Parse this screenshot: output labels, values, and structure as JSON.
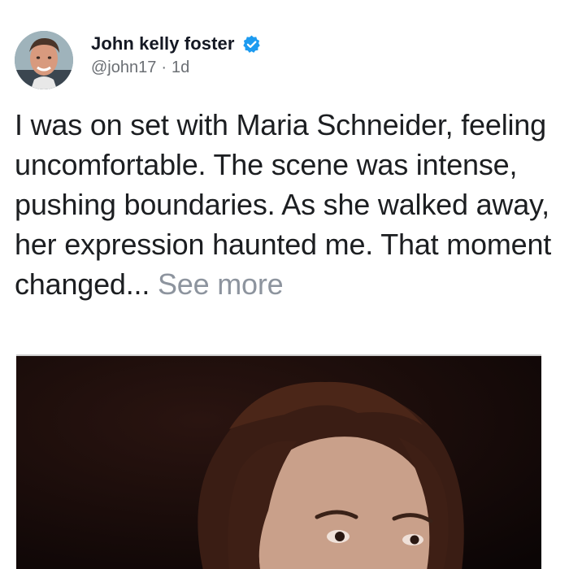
{
  "post": {
    "author_name": "John kelly foster",
    "verified_icon": "verified-badge-icon",
    "handle": "@john17",
    "separator": "·",
    "time_ago": "1d",
    "body_text": "I was on set with Maria Schneider, feeling uncomfortable. The scene was intense, pushing boundaries. As she walked away, her expression haunted me. That moment changed...",
    "see_more_label": "See more"
  },
  "colors": {
    "verified_blue": "#1d9bf0",
    "muted_text": "#8d949e",
    "body_text": "#1c1e21"
  }
}
